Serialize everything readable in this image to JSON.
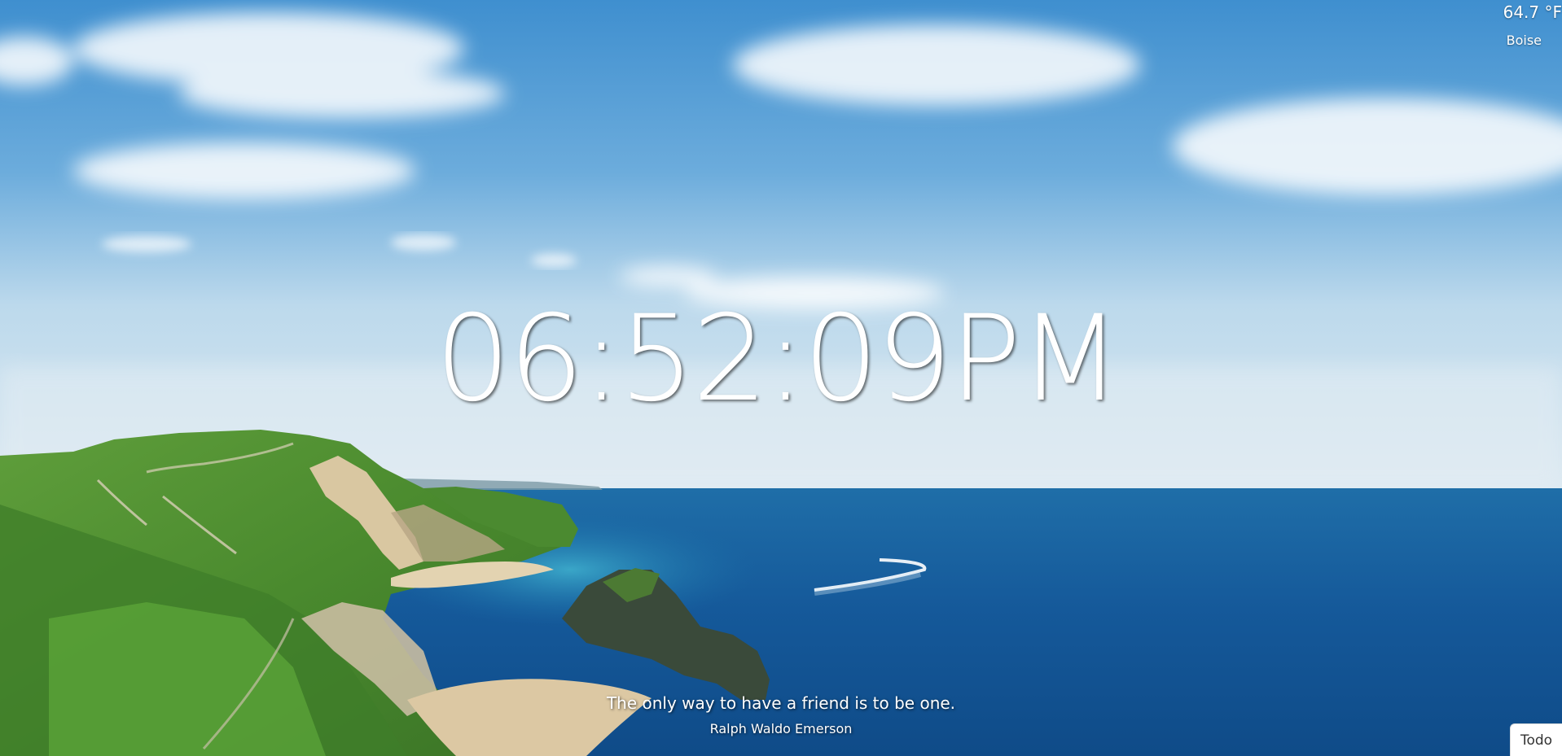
{
  "weather": {
    "temperature": "64.7 °F",
    "city": "Boise"
  },
  "clock": {
    "time": "06:52:09PM"
  },
  "quote": {
    "text": "The only way to have a friend is to be one.",
    "author": "Ralph Waldo Emerson"
  },
  "todo": {
    "label": "Todo"
  }
}
